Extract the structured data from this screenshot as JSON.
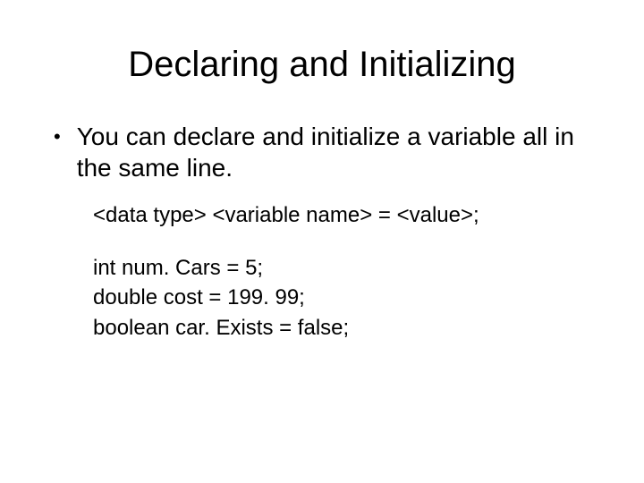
{
  "title": "Declaring and Initializing",
  "bullet": {
    "text": "You can declare and initialize a variable all in the same line."
  },
  "syntax": "<data type> <variable name> = <value>;",
  "examples": {
    "line1": "int num. Cars = 5;",
    "line2": "double cost = 199. 99;",
    "line3": "boolean car. Exists = false;"
  }
}
